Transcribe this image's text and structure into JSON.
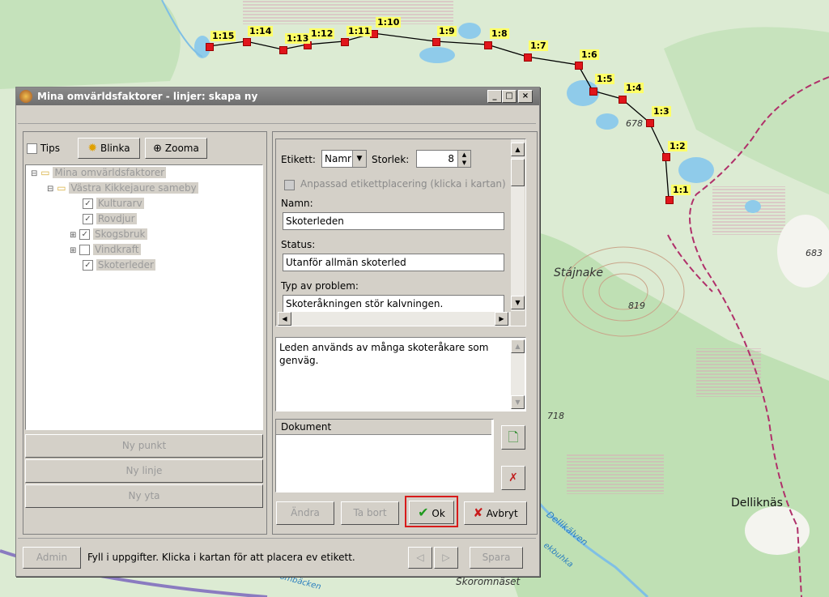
{
  "map": {
    "labels": {
      "stajnake": "Stájnake",
      "dellkinas": "Delliknäs",
      "skoromnaset": "Skoromnäset",
      "dellikalven": "Dellikälven",
      "elev_678": "678",
      "elev_683": "683",
      "elev_819": "819",
      "elev_718": "718",
      "road_fragment": "ombäcken",
      "road_fragment2": "ekbuhka"
    },
    "points": [
      "1:15",
      "1:14",
      "1:13",
      "1:12",
      "1:11",
      "1:10",
      "1:9",
      "1:8",
      "1:7",
      "1:6",
      "1:5",
      "1:4",
      "1:3",
      "1:2",
      "1:1"
    ],
    "colors": {
      "route_line": "#000000",
      "point": "#e0151b",
      "point_label_bg": "#ffff66",
      "trail": "#b0306a"
    }
  },
  "window": {
    "title": "Mina omvärldsfaktorer - linjer: skapa ny",
    "controls": {
      "minimize": "_",
      "maximize": "□",
      "close": "×"
    }
  },
  "toolbar": {
    "tips_label": "Tips",
    "blinka_label": "Blinka",
    "zooma_label": "Zooma"
  },
  "tree": {
    "root": "Mina omvärldsfaktorer",
    "group": "Västra Kikkejaure sameby",
    "items": [
      "Kulturarv",
      "Rovdjur",
      "Skogsbruk",
      "Vindkraft",
      "Skoterleder"
    ]
  },
  "left_buttons": {
    "ny_punkt": "Ny punkt",
    "ny_linje": "Ny linje",
    "ny_yta": "Ny yta"
  },
  "form": {
    "etikett_label": "Etikett:",
    "etikett_value": "Namr",
    "storlek_label": "Storlek:",
    "storlek_value": "8",
    "anpassad_label": "Anpassad etikettplacering (klicka i kartan)",
    "namn_label": "Namn:",
    "namn_value": "Skoterleden",
    "status_label": "Status:",
    "status_value": "Utanför allmän skoterled",
    "typ_label": "Typ av problem:",
    "typ_value": "Skoteråkningen stör kalvningen.",
    "description": "Leden används av många skoteråkare som genväg."
  },
  "documents": {
    "header": "Dokument"
  },
  "actions": {
    "andra": "Ändra",
    "ta_bort": "Ta bort",
    "ok": "Ok",
    "avbryt": "Avbryt"
  },
  "statusbar": {
    "admin": "Admin",
    "message": "Fyll i uppgifter. Klicka i kartan för att placera ev etikett.",
    "spara": "Spara"
  }
}
